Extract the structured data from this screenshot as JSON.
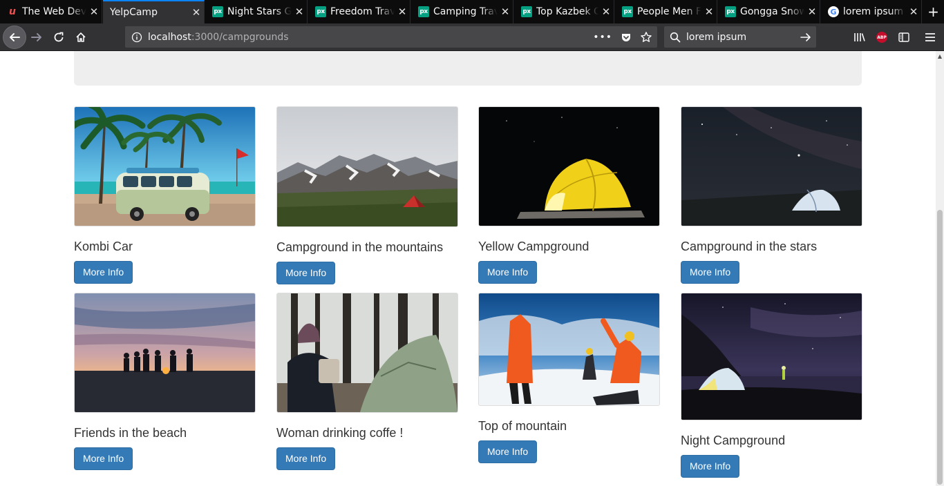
{
  "browser": {
    "tabs": [
      {
        "title": "The Web Developer Bootcamp",
        "icon": "udemy-icon",
        "active": false
      },
      {
        "title": "YelpCamp",
        "icon": "none",
        "active": true
      },
      {
        "title": "Night Stars Glow",
        "icon": "pexels-icon",
        "active": false
      },
      {
        "title": "Freedom Travel",
        "icon": "pexels-icon",
        "active": false
      },
      {
        "title": "Camping Travel",
        "icon": "pexels-icon",
        "active": false
      },
      {
        "title": "Top Kazbek Of",
        "icon": "pexels-icon",
        "active": false
      },
      {
        "title": "People Men Fl",
        "icon": "pexels-icon",
        "active": false
      },
      {
        "title": "Gongga Snow",
        "icon": "pexels-icon",
        "active": false
      },
      {
        "title": "lorem ipsum -",
        "icon": "google-icon",
        "active": false
      }
    ],
    "url_host": "localhost",
    "url_path": ":3000/campgrounds",
    "search_value": "lorem ipsum",
    "page_actions": "•••"
  },
  "campgrounds": [
    {
      "name": "Kombi Car",
      "button": "More Info",
      "image": "van-palm-beach"
    },
    {
      "name": "Campground in the mountains",
      "button": "More Info",
      "image": "mountain-tent"
    },
    {
      "name": "Yellow Campground",
      "button": "More Info",
      "image": "yellow-tent-night"
    },
    {
      "name": "Campground in the stars",
      "button": "More Info",
      "image": "tent-under-stars"
    },
    {
      "name": "Friends in the beach",
      "button": "More Info",
      "image": "beach-sunset-friends"
    },
    {
      "name": "Woman drinking coffe !",
      "button": "More Info",
      "image": "woman-coffee-forest"
    },
    {
      "name": "Top of mountain",
      "button": "More Info",
      "image": "climbers-summit"
    },
    {
      "name": "Night Campground",
      "button": "More Info",
      "image": "night-tent-lake"
    }
  ],
  "colors": {
    "primary_button": "#337ab7",
    "jumbotron": "#eeeeee",
    "tab_accent": "#0a84ff"
  }
}
